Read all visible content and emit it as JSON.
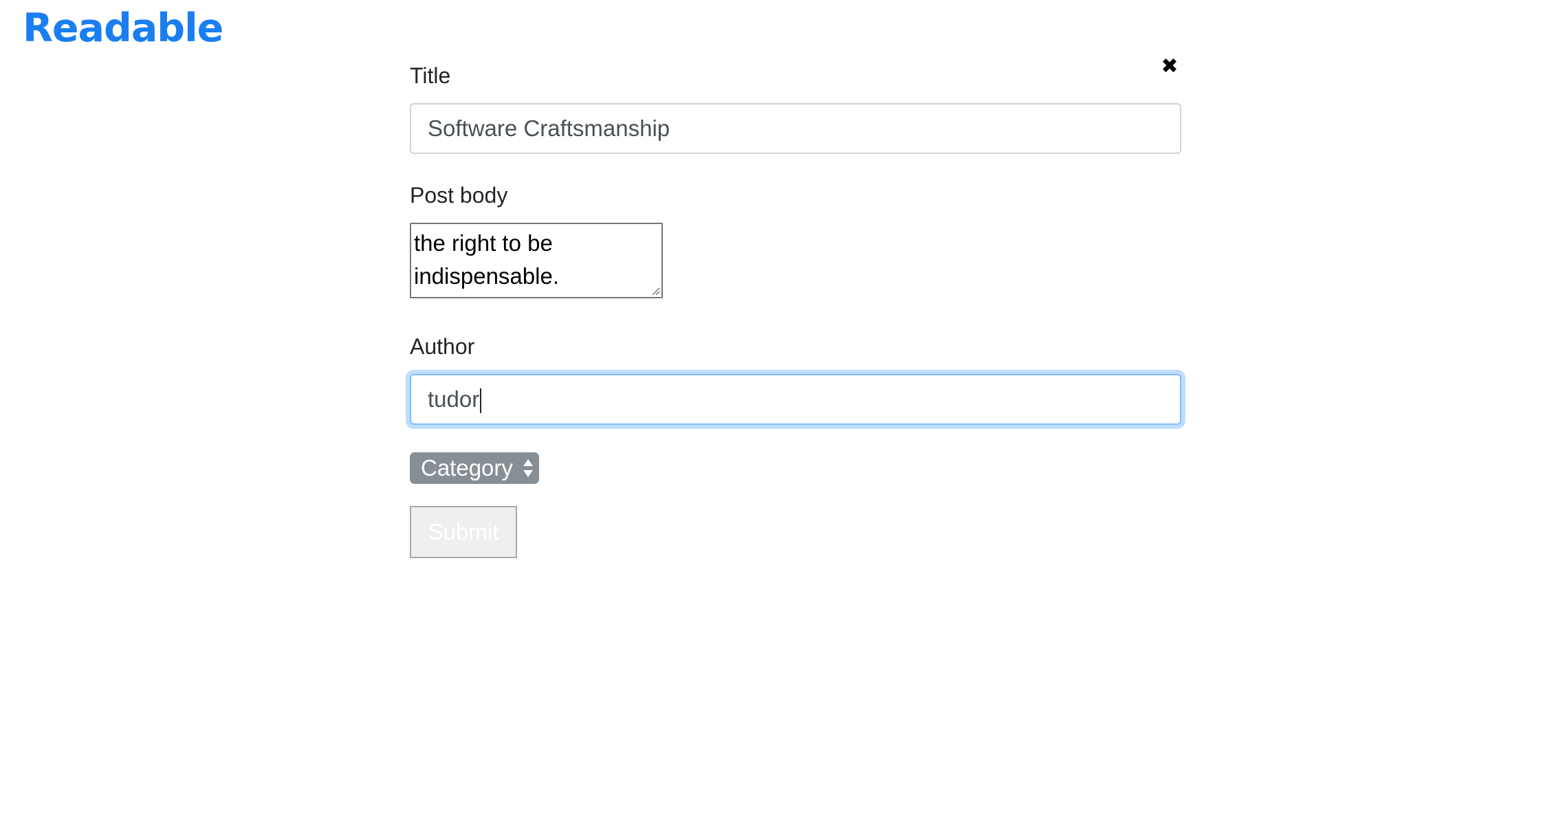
{
  "app": {
    "brand": "Readable"
  },
  "form": {
    "close_icon": "close-icon",
    "title_label": "Title",
    "title_value": "Software Craftsmanship",
    "body_label": "Post body",
    "body_value": "the right to be indispensable.",
    "author_label": "Author",
    "author_value": "tudor",
    "category_select": "Category",
    "submit_label": "Submit"
  },
  "colors": {
    "brand": "#1a7ef0",
    "select_bg": "#868e96",
    "focus_ring": "#80bdff"
  }
}
